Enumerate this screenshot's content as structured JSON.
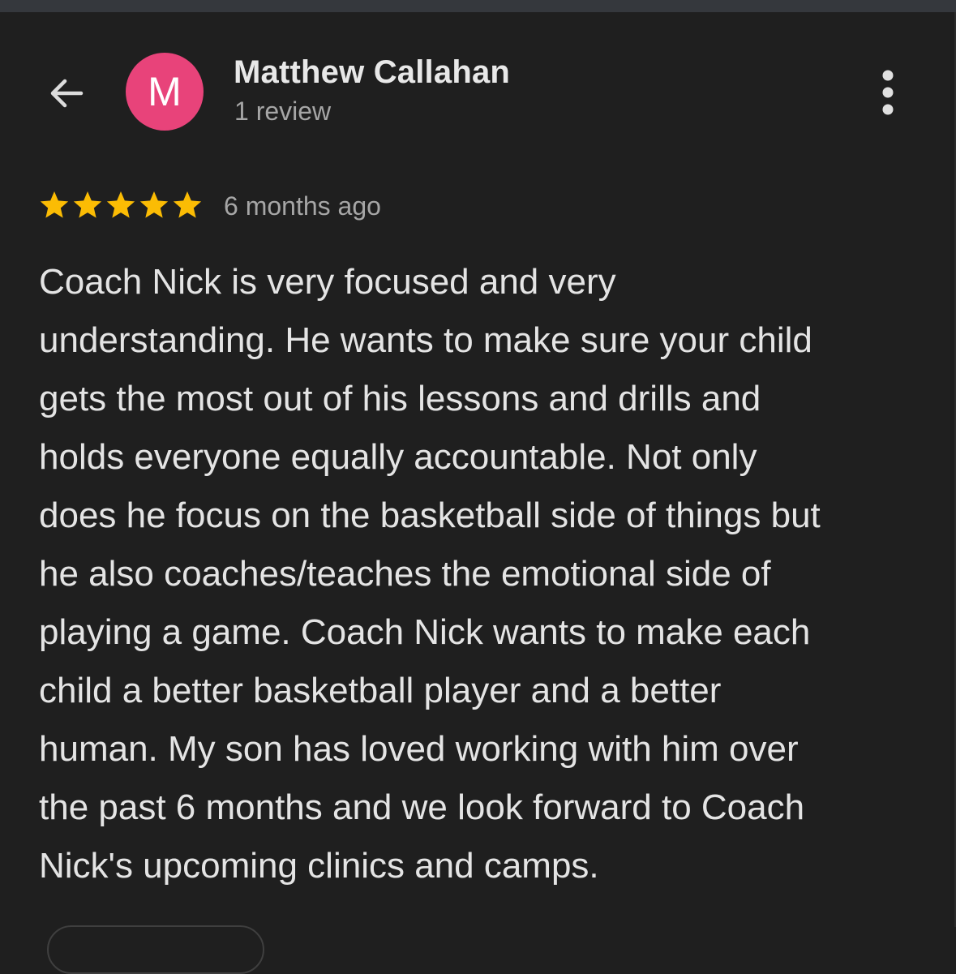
{
  "reviewer": {
    "initial": "M",
    "name": "Matthew Callahan",
    "review_count": "1 review",
    "avatar_color": "#e8437a"
  },
  "review": {
    "rating": 5,
    "max_rating": 5,
    "star_color": "#fbbc04",
    "time_ago": "6 months ago",
    "text_lines": [
      "Coach Nick is very focused and very",
      "understanding. He wants to make sure your child",
      "gets the most out of his lessons and drills and",
      "holds everyone equally accountable. Not only",
      "does he focus on the basketball side of things but",
      "he also coaches/teaches the emotional side of",
      "playing a game. Coach Nick wants to make each",
      "child a better basketball player and a better",
      "human. My son has loved working with him over",
      "the past 6 months and we look forward to Coach",
      "Nick's upcoming clinics and camps."
    ]
  },
  "icons": {
    "back": "arrow-left-icon",
    "more": "more-vertical-icon",
    "star": "star-icon"
  }
}
